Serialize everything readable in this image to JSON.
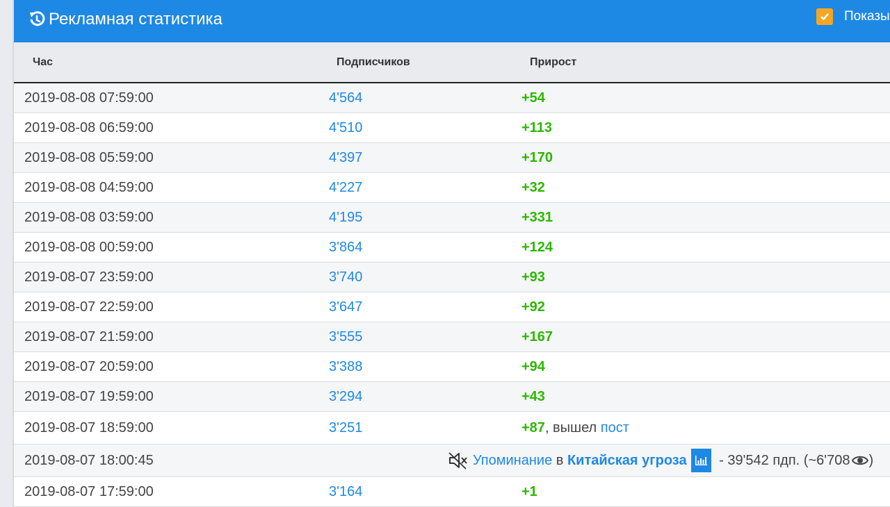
{
  "header": {
    "title": "Рекламная статистика",
    "show_toggle_label": "Показы",
    "show_toggle_checked": true,
    "accent_color": "#1e88e5",
    "checkbox_color": "#f5a623"
  },
  "table": {
    "columns": [
      "Час",
      "Подписчиков",
      "Прирост"
    ],
    "rows": [
      {
        "hour": "2019-08-08 07:59:00",
        "subs": "4'564",
        "growth": "+54"
      },
      {
        "hour": "2019-08-08 06:59:00",
        "subs": "4'510",
        "growth": "+113"
      },
      {
        "hour": "2019-08-08 05:59:00",
        "subs": "4'397",
        "growth": "+170"
      },
      {
        "hour": "2019-08-08 04:59:00",
        "subs": "4'227",
        "growth": "+32"
      },
      {
        "hour": "2019-08-08 03:59:00",
        "subs": "4'195",
        "growth": "+331"
      },
      {
        "hour": "2019-08-08 00:59:00",
        "subs": "3'864",
        "growth": "+124"
      },
      {
        "hour": "2019-08-07 23:59:00",
        "subs": "3'740",
        "growth": "+93"
      },
      {
        "hour": "2019-08-07 22:59:00",
        "subs": "3'647",
        "growth": "+92"
      },
      {
        "hour": "2019-08-07 21:59:00",
        "subs": "3'555",
        "growth": "+167"
      },
      {
        "hour": "2019-08-07 20:59:00",
        "subs": "3'388",
        "growth": "+94"
      },
      {
        "hour": "2019-08-07 19:59:00",
        "subs": "3'294",
        "growth": "+43"
      },
      {
        "hour": "2019-08-07 18:59:00",
        "subs": "3'251",
        "growth": "+87",
        "post_sep": ", вышел ",
        "post_link": "пост"
      },
      {
        "hour": "2019-08-07 18:00:45",
        "mention": {
          "icon": "mute-icon",
          "link": "Упоминание",
          "in_text": " в ",
          "channel": "Китайская угроза",
          "stats_icon": "bar-chart-icon",
          "subs_text": " - 39'542 пдп. (~6'708",
          "views_icon": "eye-icon",
          "close_paren": ")"
        }
      },
      {
        "hour": "2019-08-07 17:59:00",
        "subs": "3'164",
        "growth": "+1"
      }
    ]
  }
}
